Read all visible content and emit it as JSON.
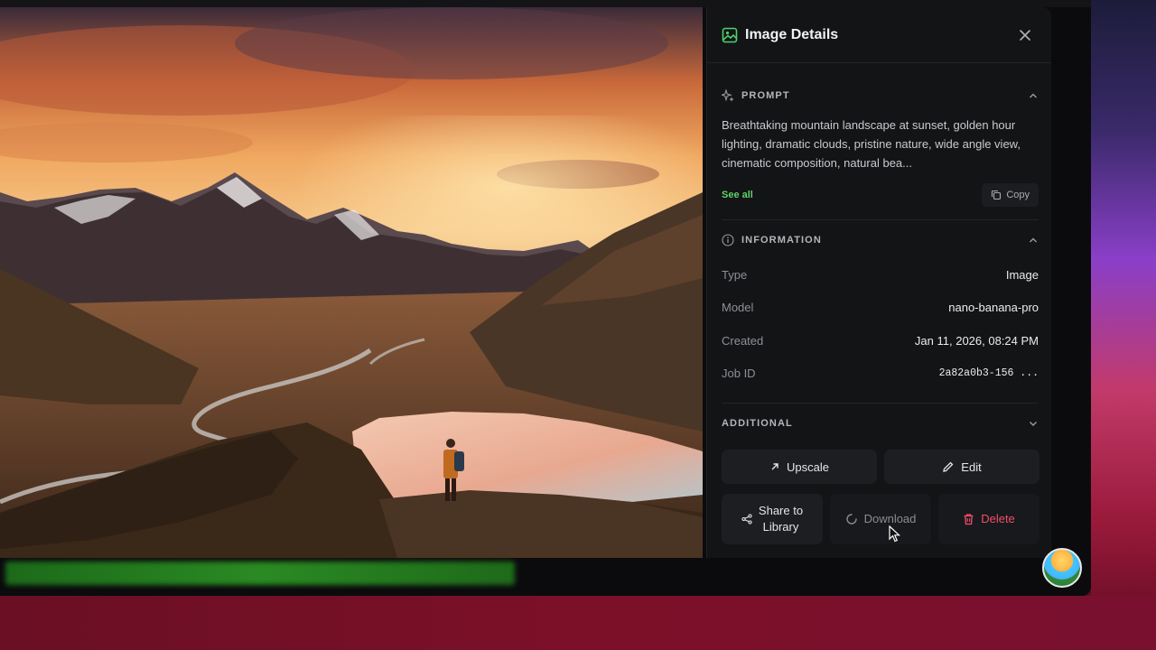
{
  "panel": {
    "title": "Image Details",
    "icons": {
      "header": "image-icon",
      "close": "close-icon"
    }
  },
  "prompt": {
    "title": "PROMPT",
    "icon": "sparkles-icon",
    "text": "Breathtaking mountain landscape at sunset, golden hour lighting, dramatic clouds, pristine nature, wide angle view, cinematic composition, natural bea...",
    "see_all": "See all",
    "copy": "Copy"
  },
  "information": {
    "title": "INFORMATION",
    "icon": "info-icon",
    "rows": [
      {
        "label": "Type",
        "value": "Image"
      },
      {
        "label": "Model",
        "value": "nano-banana-pro"
      },
      {
        "label": "Created",
        "value": "Jan 11, 2026, 08:24 PM"
      },
      {
        "label": "Job ID",
        "value": "2a82a0b3-156 ..."
      }
    ]
  },
  "additional": {
    "title": "ADDITIONAL"
  },
  "actions": {
    "upscale": "Upscale",
    "edit": "Edit",
    "share_line1": "Share to",
    "share_line2": "Library",
    "download": "Download",
    "delete": "Delete"
  },
  "colors": {
    "accent_green": "#5fd06a",
    "danger": "#ef4f6a",
    "panel_bg": "#131416"
  }
}
